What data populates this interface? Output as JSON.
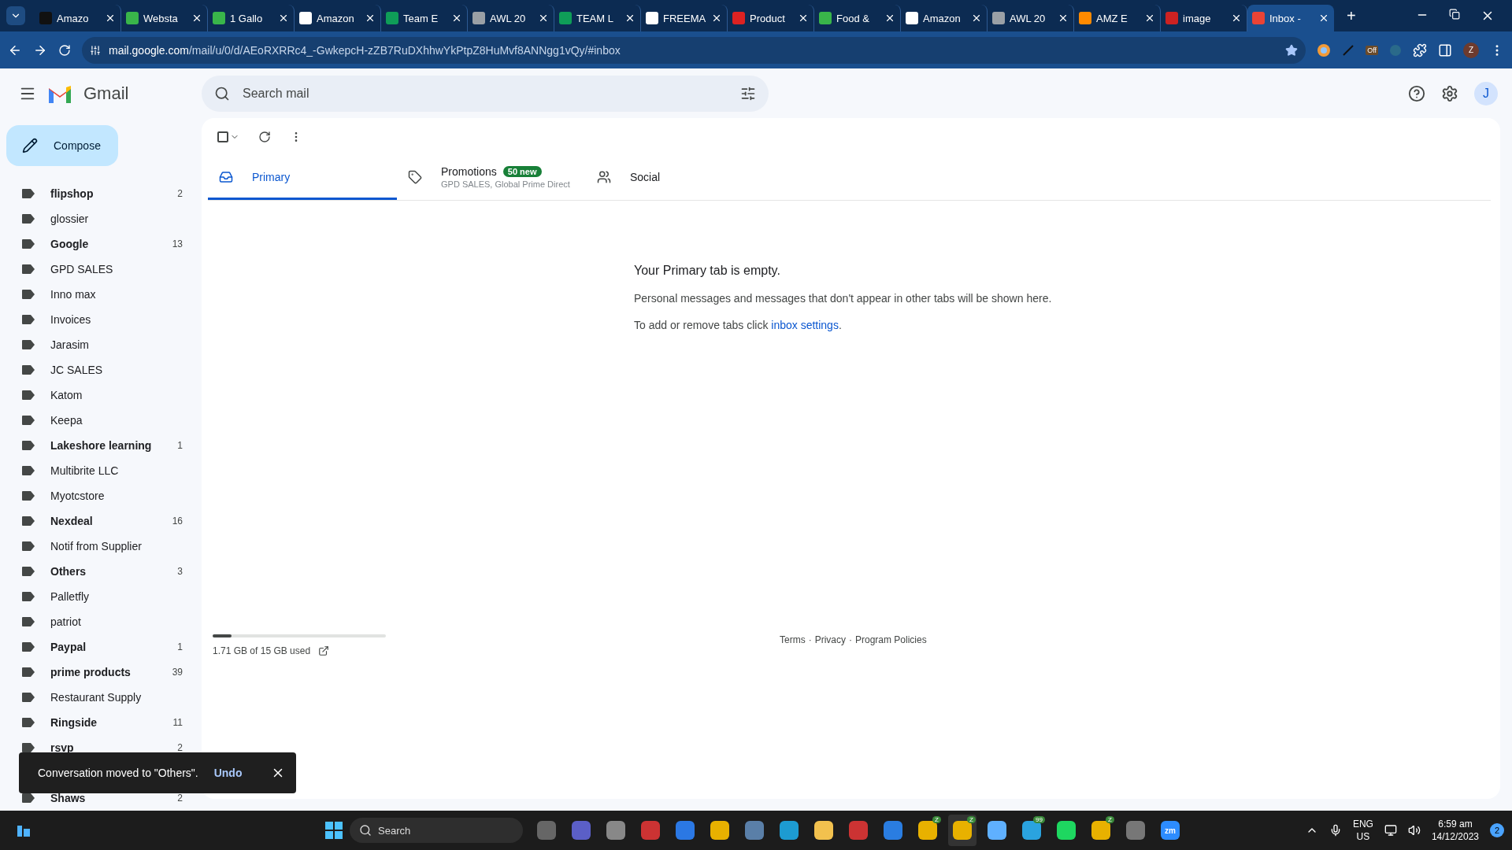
{
  "browser": {
    "tabs": [
      {
        "title": "Amazo",
        "kind": "amazon",
        "selected": false
      },
      {
        "title": "Websta",
        "kind": "w",
        "selected": false
      },
      {
        "title": "1 Gallo",
        "kind": "w",
        "selected": false
      },
      {
        "title": "Amazon",
        "kind": "amazon-light",
        "selected": false
      },
      {
        "title": "Team E",
        "kind": "sheets",
        "selected": false
      },
      {
        "title": "AWL 20",
        "kind": "globe",
        "selected": false
      },
      {
        "title": "TEAM L",
        "kind": "sheets",
        "selected": false
      },
      {
        "title": "FREEMA",
        "kind": "google",
        "selected": false
      },
      {
        "title": "Product",
        "kind": "jc",
        "selected": false
      },
      {
        "title": "Food &",
        "kind": "w",
        "selected": false
      },
      {
        "title": "Amazon",
        "kind": "amazon-light",
        "selected": false
      },
      {
        "title": "AWL 20",
        "kind": "globe",
        "selected": false
      },
      {
        "title": "AMZ E",
        "kind": "amz",
        "selected": false
      },
      {
        "title": "image",
        "kind": "image",
        "selected": false
      },
      {
        "title": "Inbox -",
        "kind": "gmail",
        "selected": true
      }
    ],
    "new_tab": "+",
    "url_host": "mail.google.com",
    "url_path": "/mail/u/0/d/AEoRXRRc4_-GwkepcH-zZB7RuDXhhwYkPtpZ8HuMvf8ANNgg1vQy/#inbox",
    "extension_badge": "Off",
    "profile": "Z"
  },
  "gmail": {
    "brand": "Gmail",
    "search": {
      "placeholder": "Search mail"
    },
    "account": "J",
    "compose": "Compose",
    "labels": [
      {
        "name": "flipshop",
        "count": "2",
        "unread": true
      },
      {
        "name": "glossier",
        "unread": false
      },
      {
        "name": "Google",
        "count": "13",
        "unread": true
      },
      {
        "name": "GPD SALES",
        "unread": false
      },
      {
        "name": "Inno max",
        "unread": false
      },
      {
        "name": "Invoices",
        "unread": false
      },
      {
        "name": "Jarasim",
        "unread": false
      },
      {
        "name": "JC SALES",
        "unread": false
      },
      {
        "name": "Katom",
        "unread": false
      },
      {
        "name": "Keepa",
        "unread": false
      },
      {
        "name": "Lakeshore learning",
        "count": "1",
        "unread": true
      },
      {
        "name": "Multibrite LLC",
        "unread": false
      },
      {
        "name": "Myotcstore",
        "unread": false
      },
      {
        "name": "Nexdeal",
        "count": "16",
        "unread": true
      },
      {
        "name": "Notif from Supplier",
        "unread": false
      },
      {
        "name": "Others",
        "count": "3",
        "unread": true
      },
      {
        "name": "Palletfly",
        "unread": false
      },
      {
        "name": "patriot",
        "unread": false
      },
      {
        "name": "Paypal",
        "count": "1",
        "unread": true
      },
      {
        "name": "prime products",
        "count": "39",
        "unread": true
      },
      {
        "name": "Restaurant Supply",
        "unread": false
      },
      {
        "name": "Ringside",
        "count": "11",
        "unread": true
      },
      {
        "name": "rsvp",
        "count": "2",
        "unread": true
      },
      {
        "name": "Shaws",
        "count": "2",
        "unread": true
      }
    ],
    "inbox_tabs": [
      {
        "label": "Primary",
        "kind": "inbox",
        "selected": true
      },
      {
        "label": "Promotions",
        "kind": "tag",
        "selected": false,
        "badge": "50 new",
        "subtitle": "GPD SALES, Global Prime Direct"
      },
      {
        "label": "Social",
        "kind": "people",
        "selected": false
      }
    ],
    "empty": {
      "title": "Your Primary tab is empty.",
      "body": "Personal messages and messages that don't appear in other tabs will be shown here.",
      "hint": "To add or remove tabs click ",
      "link": "inbox settings",
      "hint_end": "."
    },
    "storage": {
      "text": "1.71 GB of 15 GB used",
      "level": 0.11
    },
    "footer_links": [
      "Terms",
      "Privacy",
      "Program Policies"
    ],
    "footer_separator": "·",
    "select_all": {
      "checked": false
    },
    "snackbar": {
      "message": "Conversation moved to \"Others\".",
      "action": "Undo"
    }
  },
  "taskbar": {
    "search": "Search",
    "apps": [
      {
        "kind": "taskview"
      },
      {
        "kind": "meet"
      },
      {
        "kind": "settings"
      },
      {
        "kind": "redapp"
      },
      {
        "kind": "store"
      },
      {
        "kind": "chrome"
      },
      {
        "kind": "remote"
      },
      {
        "kind": "edge"
      },
      {
        "kind": "folder"
      },
      {
        "kind": "redapp"
      },
      {
        "kind": "mail"
      },
      {
        "kind": "chrome",
        "badge": "Z"
      },
      {
        "kind": "chrome",
        "badge": "Z",
        "active": true
      },
      {
        "kind": "notepad"
      },
      {
        "kind": "telegram",
        "badge": "99"
      },
      {
        "kind": "spotify"
      },
      {
        "kind": "chrome",
        "badge": "Z"
      },
      {
        "kind": "calculator"
      },
      {
        "kind": "zoom",
        "label": "zm"
      }
    ],
    "language": "ENG",
    "region": "US",
    "time": "6:59 am",
    "date": "14/12/2023",
    "notifications": "2"
  }
}
